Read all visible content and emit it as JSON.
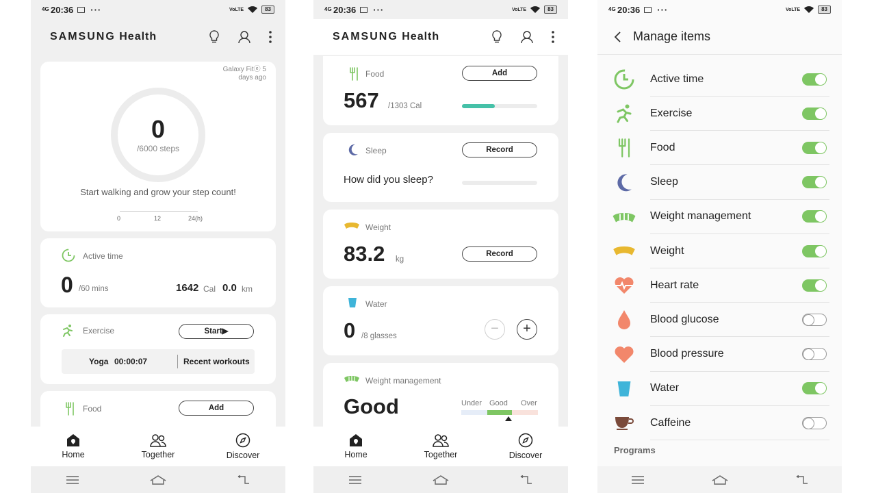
{
  "status": {
    "network": "4G",
    "time": "20:36",
    "dots": "···",
    "lte": "VoLTE",
    "battery": "83"
  },
  "app": {
    "name_brand": "SAMSUNG",
    "name_rest": "Health"
  },
  "nav": {
    "home": "Home",
    "together": "Together",
    "discover": "Discover"
  },
  "steps": {
    "device": "Galaxy Fitⓔ 5 days ago",
    "count": "0",
    "goal": "/6000 steps",
    "message": "Start walking and grow your step count!",
    "ticks": [
      "0",
      "12",
      "24(h)"
    ]
  },
  "active_time": {
    "title": "Active time",
    "value": "0",
    "goal": "/60 mins",
    "cal_value": "1642",
    "cal_unit": "Cal",
    "km_value": "0.0",
    "km_unit": "km"
  },
  "exercise": {
    "title": "Exercise",
    "start": "Start▶",
    "last_type": "Yoga",
    "last_duration": "00:00:07",
    "recent": "Recent workouts"
  },
  "food": {
    "title": "Food",
    "add": "Add",
    "value": "567",
    "goal": "/1303 Cal",
    "progress": 0.44
  },
  "sleep": {
    "title": "Sleep",
    "record": "Record",
    "question": "How did you sleep?"
  },
  "weight": {
    "title": "Weight",
    "value": "83.2",
    "unit": "kg",
    "record": "Record"
  },
  "water": {
    "title": "Water",
    "value": "0",
    "goal": "/8 glasses",
    "minus": "−",
    "plus": "+"
  },
  "weight_mgmt": {
    "title": "Weight management",
    "status": "Good",
    "scale": [
      "Under",
      "Good",
      "Over"
    ]
  },
  "manage": {
    "title": "Manage items",
    "items": [
      {
        "label": "Active time",
        "on": true,
        "icon": "active-time-icon"
      },
      {
        "label": "Exercise",
        "on": true,
        "icon": "running-icon"
      },
      {
        "label": "Food",
        "on": true,
        "icon": "food-icon"
      },
      {
        "label": "Sleep",
        "on": true,
        "icon": "moon-icon"
      },
      {
        "label": "Weight management",
        "on": true,
        "icon": "weight-management-icon"
      },
      {
        "label": "Weight",
        "on": true,
        "icon": "weight-icon"
      },
      {
        "label": "Heart rate",
        "on": true,
        "icon": "heart-rate-icon"
      },
      {
        "label": "Blood glucose",
        "on": false,
        "icon": "blood-drop-icon"
      },
      {
        "label": "Blood pressure",
        "on": false,
        "icon": "heart-icon"
      },
      {
        "label": "Water",
        "on": true,
        "icon": "water-glass-icon"
      },
      {
        "label": "Caffeine",
        "on": false,
        "icon": "coffee-cup-icon"
      }
    ],
    "programs": "Programs"
  },
  "colors": {
    "green": "#7ec663",
    "teal": "#45c1a8",
    "accent": "#e8b830"
  }
}
